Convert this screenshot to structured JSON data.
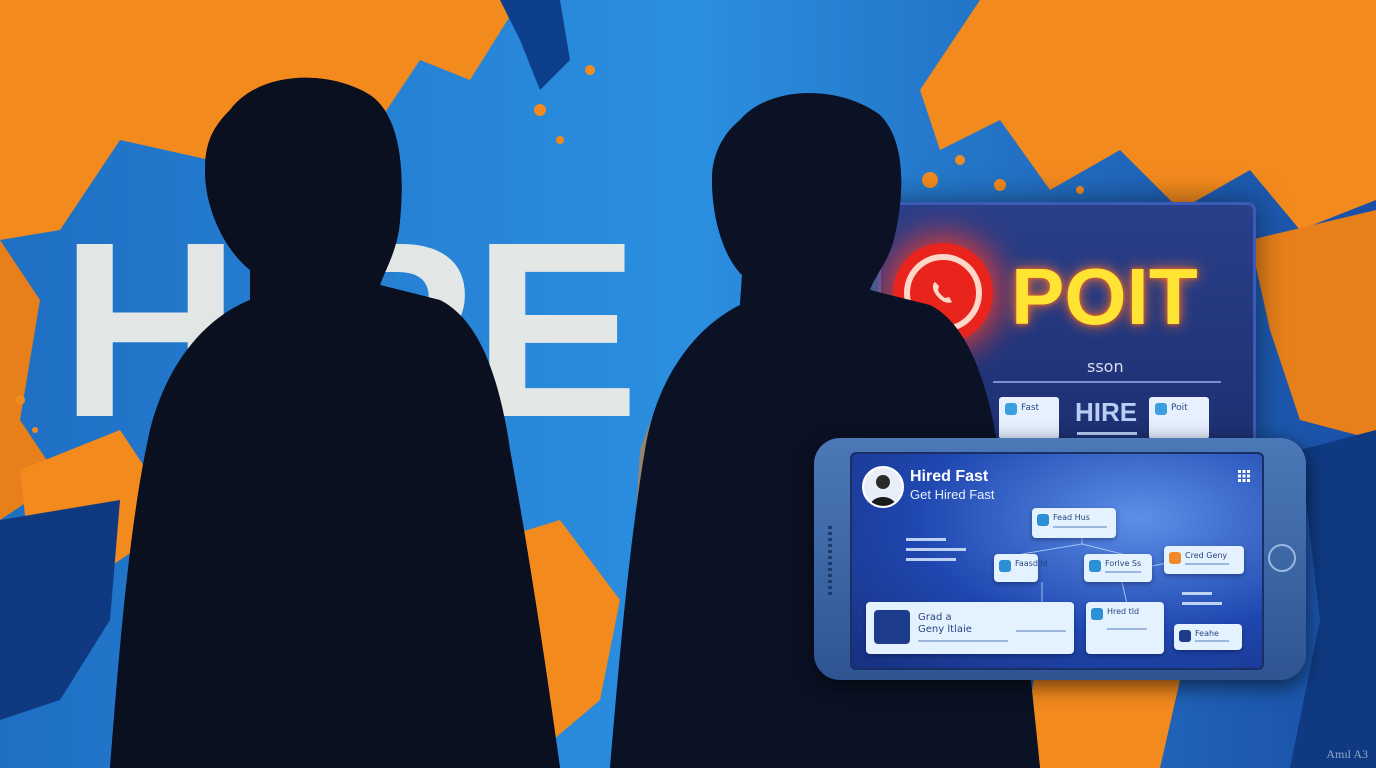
{
  "scene": {
    "wall_text": "HiRE",
    "colors": {
      "orange": "#f28a1e",
      "blue": "#1f7fd6",
      "navy": "#0f1c3a",
      "silhouette": "#0a1020"
    }
  },
  "board": {
    "title": "POIT",
    "subtitle": "sson",
    "hire": "HIRE",
    "cards": [
      {
        "label": "Fast",
        "icon": "chat-icon"
      },
      {
        "label": "Poit",
        "icon": "phone-icon"
      }
    ]
  },
  "phone": {
    "app_title": "Hired Fast",
    "app_subtitle": "Get Hired Fast",
    "cards": {
      "top": "Fead Hus",
      "left": "Faasd ld",
      "middle": "Forlve Ss",
      "right": "Cred Geny",
      "bottom_big": "Grad a\nGeny ltlaie",
      "bottom_mid": "Hred tld",
      "bottom_right": "Feahe"
    }
  },
  "signature": "Amıl A3"
}
